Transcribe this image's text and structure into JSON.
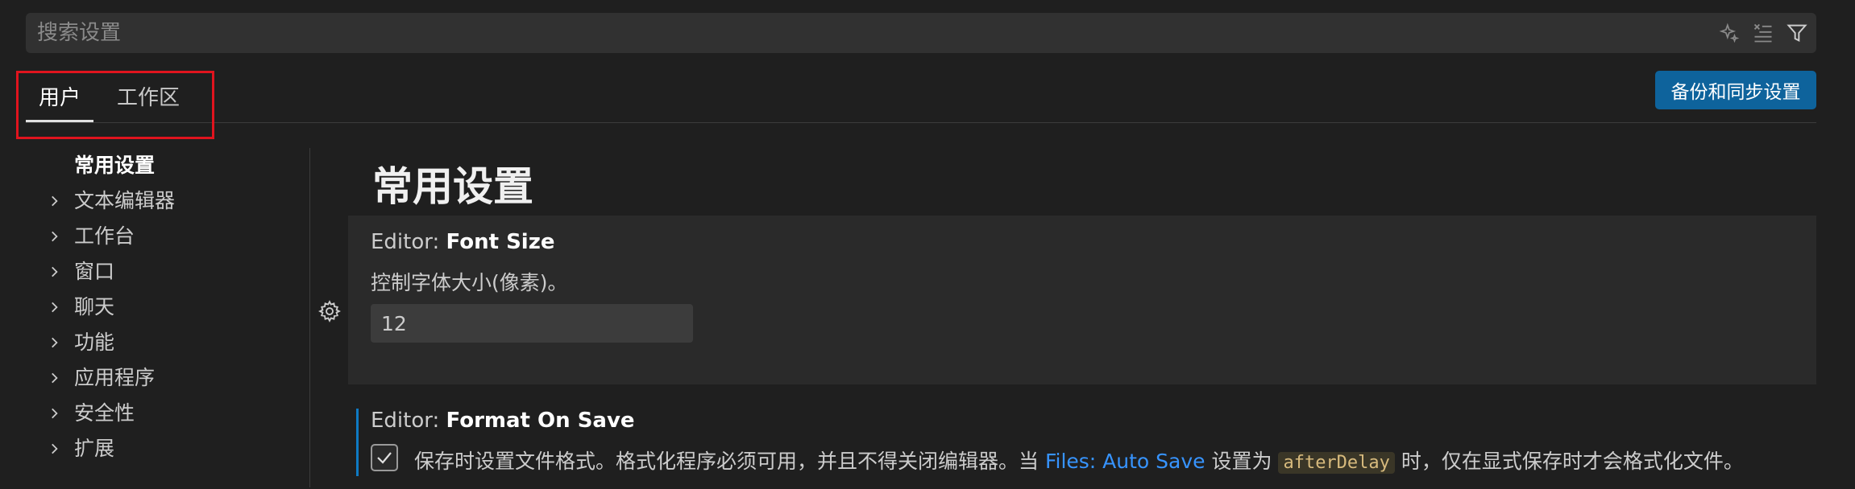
{
  "search": {
    "placeholder": "搜索设置",
    "value": "",
    "icons": [
      "sparkle-icon",
      "clear-filter-icon",
      "filter-icon"
    ]
  },
  "tabs": [
    {
      "label": "用户",
      "active": true
    },
    {
      "label": "工作区",
      "active": false
    }
  ],
  "sync_button": "备份和同步设置",
  "toc": {
    "items": [
      {
        "label": "常用设置",
        "expandable": false,
        "active": true
      },
      {
        "label": "文本编辑器",
        "expandable": true
      },
      {
        "label": "工作台",
        "expandable": true
      },
      {
        "label": "窗口",
        "expandable": true
      },
      {
        "label": "聊天",
        "expandable": true
      },
      {
        "label": "功能",
        "expandable": true
      },
      {
        "label": "应用程序",
        "expandable": true
      },
      {
        "label": "安全性",
        "expandable": true
      },
      {
        "label": "扩展",
        "expandable": true
      }
    ]
  },
  "main": {
    "section_title": "常用设置",
    "settings": [
      {
        "category": "Editor: ",
        "name": "Font Size",
        "description": "控制字体大小(像素)。",
        "value": "12"
      },
      {
        "category": "Editor: ",
        "name": "Format On Save",
        "checked": true,
        "description_before": "保存时设置文件格式。格式化程序必须可用，并且不得关闭编辑器。当 ",
        "link_text": "Files: Auto Save",
        "description_middle": " 设置为 ",
        "code_text": "afterDelay",
        "description_after": " 时，仅在显式保存时才会格式化文件。"
      }
    ]
  },
  "colors": {
    "background": "#1f1f1f",
    "accent_button": "#0e639c",
    "link": "#3794ff",
    "highlight_box": "#e0141e",
    "modified_indicator": "#0e7ac4"
  }
}
